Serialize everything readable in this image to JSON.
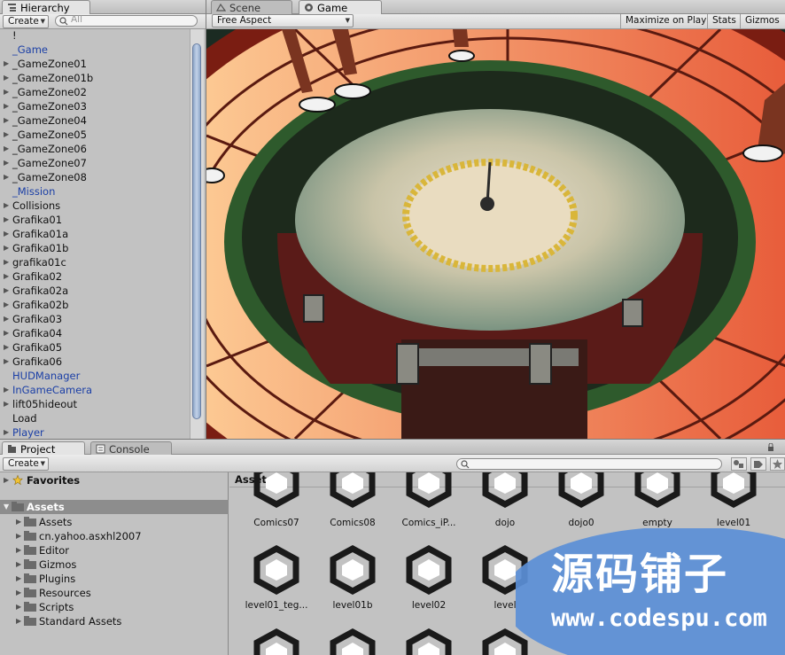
{
  "hierarchy": {
    "tab_label": "Hierarchy",
    "create_label": "Create",
    "search_placeholder": "All",
    "items": [
      {
        "label": "!",
        "arrow": false,
        "color": "black"
      },
      {
        "label": "_Game",
        "arrow": false,
        "color": "blue"
      },
      {
        "label": "_GameZone01",
        "arrow": true,
        "color": "black"
      },
      {
        "label": "_GameZone01b",
        "arrow": true,
        "color": "black"
      },
      {
        "label": "_GameZone02",
        "arrow": true,
        "color": "black"
      },
      {
        "label": "_GameZone03",
        "arrow": true,
        "color": "black"
      },
      {
        "label": "_GameZone04",
        "arrow": true,
        "color": "black"
      },
      {
        "label": "_GameZone05",
        "arrow": true,
        "color": "black"
      },
      {
        "label": "_GameZone06",
        "arrow": true,
        "color": "black"
      },
      {
        "label": "_GameZone07",
        "arrow": true,
        "color": "black"
      },
      {
        "label": "_GameZone08",
        "arrow": true,
        "color": "black"
      },
      {
        "label": "_Mission",
        "arrow": false,
        "color": "blue"
      },
      {
        "label": "Collisions",
        "arrow": true,
        "color": "black"
      },
      {
        "label": "Grafika01",
        "arrow": true,
        "color": "black"
      },
      {
        "label": "Grafika01a",
        "arrow": true,
        "color": "black"
      },
      {
        "label": "Grafika01b",
        "arrow": true,
        "color": "black"
      },
      {
        "label": "grafika01c",
        "arrow": true,
        "color": "black"
      },
      {
        "label": "Grafika02",
        "arrow": true,
        "color": "black"
      },
      {
        "label": "Grafika02a",
        "arrow": true,
        "color": "black"
      },
      {
        "label": "Grafika02b",
        "arrow": true,
        "color": "black"
      },
      {
        "label": "Grafika03",
        "arrow": true,
        "color": "black"
      },
      {
        "label": "Grafika04",
        "arrow": true,
        "color": "black"
      },
      {
        "label": "Grafika05",
        "arrow": true,
        "color": "black"
      },
      {
        "label": "Grafika06",
        "arrow": true,
        "color": "black"
      },
      {
        "label": "HUDManager",
        "arrow": false,
        "color": "blue"
      },
      {
        "label": "InGameCamera",
        "arrow": true,
        "color": "blue"
      },
      {
        "label": "lift05hideout",
        "arrow": true,
        "color": "black"
      },
      {
        "label": "Load",
        "arrow": false,
        "color": "black"
      },
      {
        "label": "Player",
        "arrow": true,
        "color": "blue"
      }
    ]
  },
  "scene_tab": {
    "label": "Scene"
  },
  "game_tab": {
    "label": "Game"
  },
  "game_toolbar": {
    "aspect": "Free Aspect",
    "maximize": "Maximize on Play",
    "stats": "Stats",
    "gizmos": "Gizmos"
  },
  "project": {
    "tab_label": "Project",
    "console_tab_label": "Console",
    "create_label": "Create",
    "favorites_label": "Favorites",
    "assets_root": "Assets",
    "folders": [
      "Assets",
      "cn.yahoo.asxhl2007",
      "Editor",
      "Gizmos",
      "Plugins",
      "Resources",
      "Scripts",
      "Standard Assets"
    ],
    "breadcrumb": "Assets",
    "assets_row1": [
      "Comics07",
      "Comics08",
      "Comics_iP...",
      "dojo",
      "dojo0",
      "empty",
      "level01"
    ],
    "assets_row2": [
      "level01_teg...",
      "level01b",
      "level02",
      "level"
    ]
  },
  "watermark": {
    "cn_text": "源码铺子",
    "url": "www.codespu.com"
  },
  "colors": {
    "selection_bg": "#8d8d8d",
    "blue_text": "#1b3fa6",
    "watermark_blue": "#5b8fd6"
  }
}
